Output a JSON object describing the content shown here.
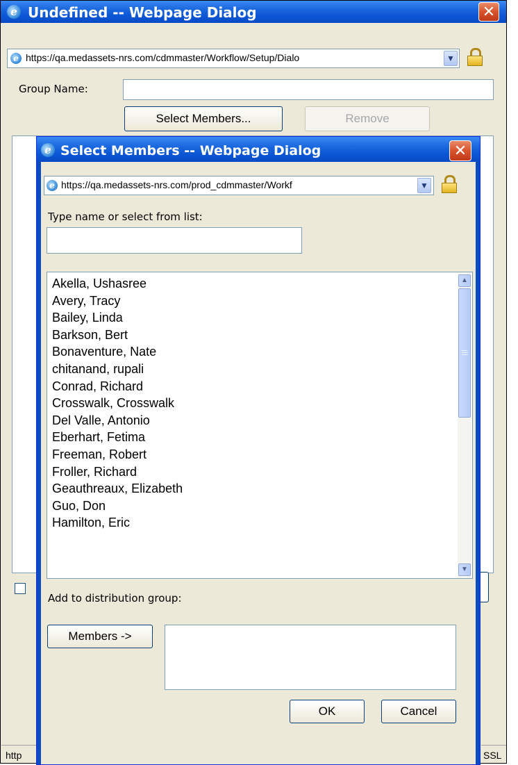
{
  "outer_dialog": {
    "title": "Undefined -- Webpage Dialog",
    "address": "https://qa.medassets-nrs.com/cdmmaster/Workflow/Setup/Dialo",
    "group_name_label": "Group Name:",
    "group_name_value": "",
    "select_members_label": "Select Members...",
    "remove_label": "Remove",
    "status_left": "http",
    "status_right": "SSL"
  },
  "inner_dialog": {
    "title": "Select Members -- Webpage Dialog",
    "address": "https://qa.medassets-nrs.com/prod_cdmmaster/Workf",
    "type_name_label": "Type name or select from list:",
    "type_name_value": "",
    "members": [
      "Akella, Ushasree",
      "Avery, Tracy",
      "Bailey, Linda",
      "Barkson, Bert",
      "Bonaventure, Nate",
      "chitanand, rupali",
      "Conrad, Richard",
      "Crosswalk, Crosswalk",
      "Del Valle, Antonio",
      "Eberhart, Fetima",
      "Freeman, Robert",
      "Froller, Richard",
      "Geauthreaux, Elizabeth",
      "Guo, Don",
      "Hamilton, Eric"
    ],
    "add_to_group_label": "Add to distribution group:",
    "members_button_label": "Members ->",
    "selected_members": [],
    "ok_label": "OK",
    "cancel_label": "Cancel"
  },
  "icons": {
    "browser": "internet-explorer-icon",
    "close": "close-icon",
    "lock": "lock-icon",
    "dropdown": "chevron-down-icon",
    "scroll_up": "scroll-up-icon",
    "scroll_down": "scroll-down-icon"
  },
  "colors": {
    "title_bar": "#0b55d4",
    "dialog_face": "#ece9d8",
    "close_button": "#d8532b",
    "field_border": "#7f9db9"
  }
}
